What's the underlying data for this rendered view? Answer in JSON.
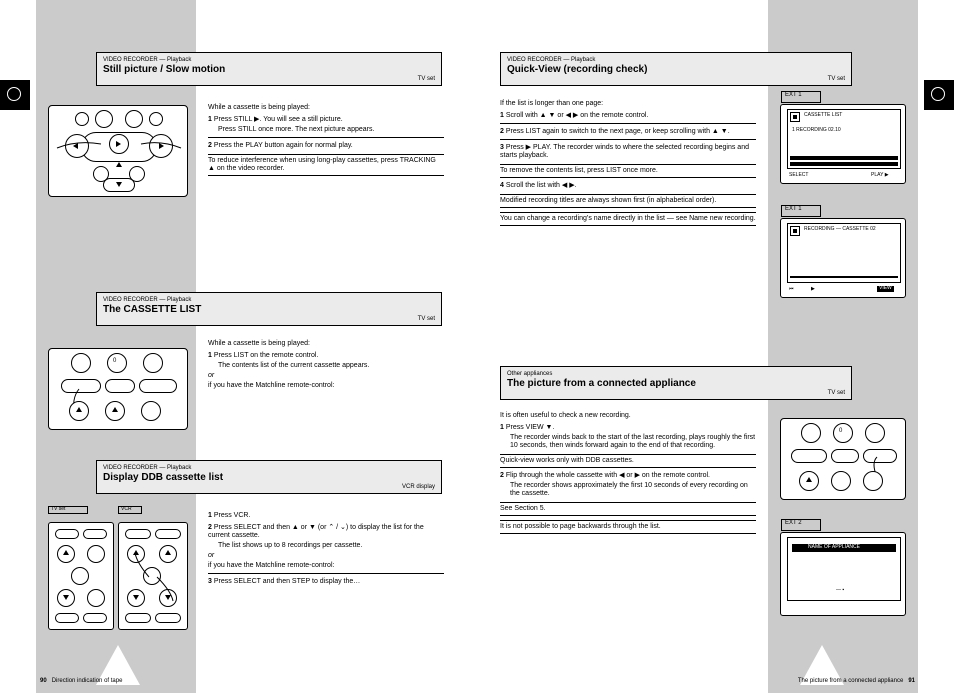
{
  "pageLeft": {
    "number": "90",
    "section": "Direction indication of tape"
  },
  "pageRight": {
    "number": "91",
    "section": "The picture from a connected appliance"
  },
  "headers": {
    "h1": {
      "tag": "VIDEO RECORDER — Playback",
      "title": "Still picture / Slow motion",
      "sub": "TV set"
    },
    "h2": {
      "tag": "VIDEO RECORDER — Playback",
      "title": "The CASSETTE LIST",
      "sub": "TV set"
    },
    "h3": {
      "tag": "VIDEO RECORDER — Playback",
      "title": "Display DDB cassette list",
      "sub": "VCR display"
    },
    "h4": {
      "tag": "VIDEO RECORDER — Playback",
      "title": "Quick-View (recording check)",
      "sub": "TV set"
    },
    "h5": {
      "tag": "Other appliances",
      "title": "The picture from a connected appliance",
      "sub": "TV set"
    }
  },
  "textA": {
    "pre": "While a cassette is being played:",
    "s1": "Press STILL ▶. You will see a still picture.",
    "s1n": "Press STILL once more. The next picture appears.",
    "s2": "Press the PLAY button again for normal play.",
    "note": "To reduce interference when using long-play cassettes, press TRACKING ▲ on the video recorder."
  },
  "textB": {
    "pre": "While a cassette is being played:",
    "s1": "Press LIST on the remote control.",
    "hint": "The contents list of the current cassette appears.",
    "or": "or",
    "alt": "if you have the Matchline remote-control:"
  },
  "textC": {
    "s1": "Press VCR.",
    "s2": "Press SELECT and then ▲ or ▼ (or ⌃ / ⌄) to display the list for the current cassette.",
    "hint": "The list shows up to 8 recordings per cassette.",
    "or": "or",
    "alt": "if you have the Matchline remote-control:",
    "s3": "Press SELECT and then STEP to display the…"
  },
  "textD": {
    "lead": "If the list is longer than one page:",
    "s1": "Scroll with ▲ ▼ or ◀ ▶ on the remote control.",
    "s2": "Press LIST again to switch to the next page, or keep scrolling with ▲ ▼.",
    "s3": "Press ▶ PLAY. The recorder winds to where the selected recording begins and starts playback.",
    "note1": "To remove the contents list, press LIST once more.",
    "s4": "Scroll the list with ◀ ▶.",
    "note2": "Modified recording titles are always shown first (in alphabetical order).",
    "note3": "You can change a recording’s name directly in the list — see Name new recording."
  },
  "textE": {
    "pre": "It is often useful to check a new recording.",
    "s1": "Press VIEW ▼.",
    "hint": "The recorder winds back to the start of the last recording, plays roughly the first 10 seconds, then winds forward again to the end of that recording.",
    "note1": "Quick-view works only with DDB cassettes.",
    "s2": "Flip through the whole cassette with ◀ or ▶ on the remote control.",
    "hint2": "The recorder shows approximately the first 10 seconds of every recording on the cassette.",
    "note2": "See Section 5.",
    "note3": "It is not possible to page backwards through the list."
  },
  "osd1": {
    "tag": "EXT 1",
    "title": "CASSETTE LIST",
    "line": "1  RECORDING        02.10",
    "foot1": "SELECT",
    "foot2": "PLAY ▶"
  },
  "osd2": {
    "tag": "EXT 1",
    "title": "RECORDING — CASSETTE 02",
    "foot1": "⏮",
    "foot2": "▶",
    "footR": "VIEW"
  },
  "osd3": {
    "tag": "EXT 2",
    "title": "NAME OF APPLIANCE",
    "foot": "— ▪"
  }
}
